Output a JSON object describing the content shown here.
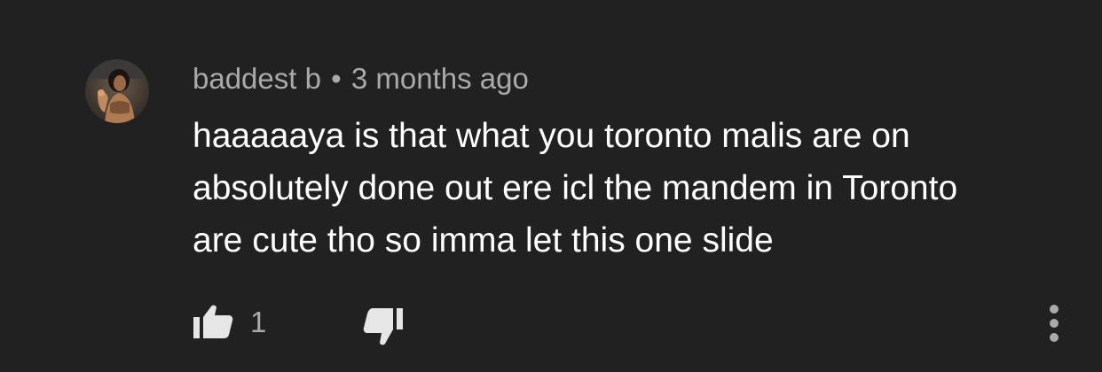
{
  "comment": {
    "author": "baddest b",
    "separator": "•",
    "timestamp": "3 months ago",
    "text_lines": [
      "haaaaaya is that what you toronto malis are on",
      "absolutely done out ere icl the mandem in Toronto",
      "are cute tho so imma let this one slide"
    ],
    "like_count": "1"
  },
  "icons": {
    "avatar": "user-avatar-photo",
    "like": "thumbs-up-icon",
    "dislike": "thumbs-down-icon",
    "more": "vertical-ellipsis-icon"
  },
  "colors": {
    "background": "#212121",
    "primary_text": "#ffffff",
    "secondary_text": "#aaaaaa",
    "icon": "#e6e6e6"
  }
}
